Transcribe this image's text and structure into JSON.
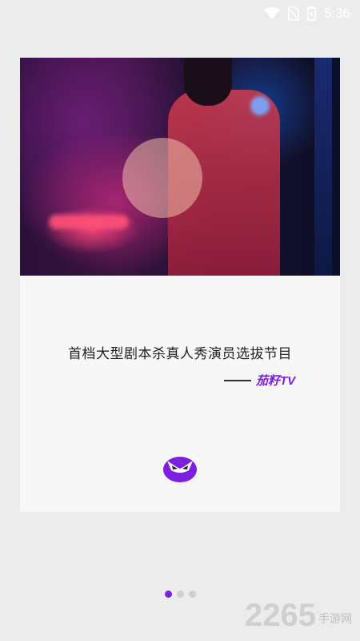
{
  "status_bar": {
    "time": "5:36",
    "icons": [
      "wifi-icon",
      "no-sim-icon",
      "battery-icon"
    ]
  },
  "slide": {
    "tagline": "首档大型剧本杀真人秀演员选拔节目",
    "brand": "茄籽TV",
    "logo": "mask-logo-icon"
  },
  "pager": {
    "total": 3,
    "current": 1
  },
  "watermark": {
    "number": "2265",
    "suffix": "手游网"
  },
  "colors": {
    "accent": "#7b1fe0",
    "background": "#ececec",
    "card": "#f7f7f7"
  }
}
